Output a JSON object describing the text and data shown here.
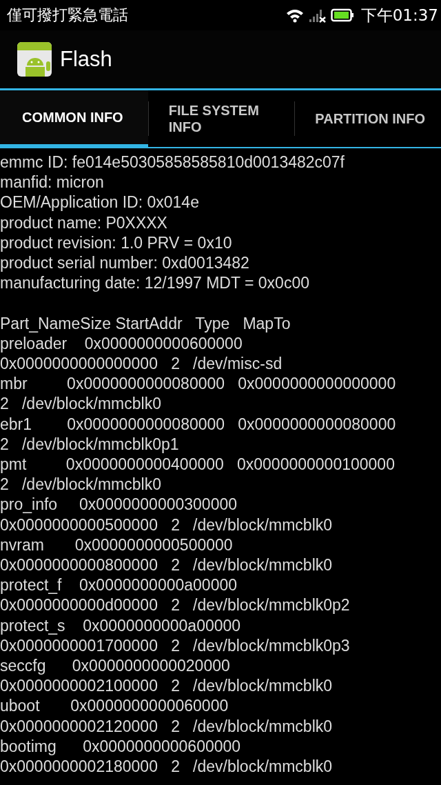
{
  "status_bar": {
    "carrier": "僅可撥打緊急電話",
    "time": "下午01:37"
  },
  "app_bar": {
    "title": "Flash"
  },
  "tabs": [
    {
      "label": "COMMON INFO",
      "selected": true
    },
    {
      "label": "FILE SYSTEM INFO",
      "selected": false
    },
    {
      "label": "PARTITION INFO",
      "selected": false
    }
  ],
  "info_lines": [
    "emmc ID: fe014e50305858585810d0013482c07f",
    "manfid: micron",
    "OEM/Application ID: 0x014e",
    "product name: P0XXXX",
    "product revision: 1.0 PRV = 0x10",
    "product serial number: 0xd0013482",
    "manufacturing date: 12/1997 MDT = 0x0c00"
  ],
  "partition_lines": [
    "Part_NameSize StartAddr   Type   MapTo",
    "preloader    0x0000000000600000",
    "0x0000000000000000   2   /dev/misc-sd",
    "mbr         0x0000000000080000   0x0000000000000000",
    "2   /dev/block/mmcblk0",
    "ebr1        0x0000000000080000   0x0000000000080000",
    "2   /dev/block/mmcblk0p1",
    "pmt         0x0000000000400000   0x0000000000100000",
    "2   /dev/block/mmcblk0",
    "pro_info     0x0000000000300000",
    "0x0000000000500000   2   /dev/block/mmcblk0",
    "nvram       0x0000000000500000",
    "0x0000000000800000   2   /dev/block/mmcblk0",
    "protect_f    0x0000000000a00000",
    "0x0000000000d00000   2   /dev/block/mmcblk0p2",
    "protect_s    0x0000000000a00000",
    "0x0000000001700000   2   /dev/block/mmcblk0p3",
    "seccfg      0x0000000000020000",
    "0x0000000002100000   2   /dev/block/mmcblk0",
    "uboot       0x0000000000060000",
    "0x0000000002120000   2   /dev/block/mmcblk0",
    "bootimg      0x0000000000600000",
    "0x0000000002180000   2   /dev/block/mmcblk0"
  ]
}
